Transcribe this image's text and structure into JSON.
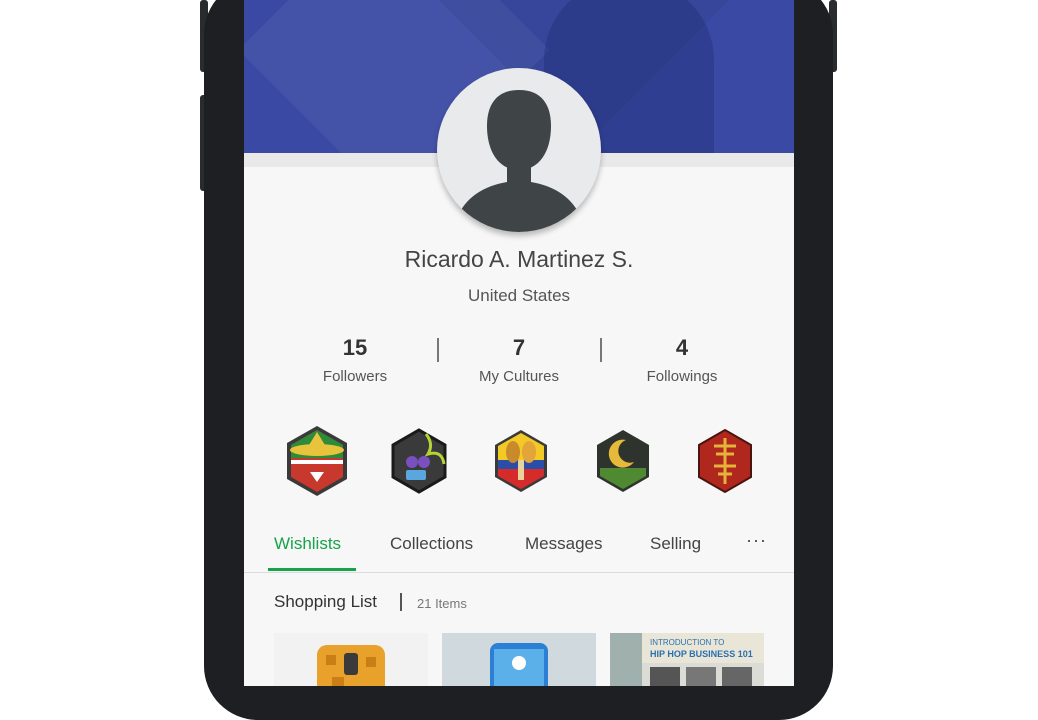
{
  "profile": {
    "name": "Ricardo A. Martinez S.",
    "country": "United States"
  },
  "stats": [
    {
      "value": "15",
      "label": "Followers"
    },
    {
      "value": "7",
      "label": "My Cultures"
    },
    {
      "value": "4",
      "label": "Followings"
    }
  ],
  "badges": [
    {
      "icon": "mexican-culture-badge-icon"
    },
    {
      "icon": "hip-hop-culture-badge-icon"
    },
    {
      "icon": "colombian-culture-badge-icon"
    },
    {
      "icon": "islamic-culture-badge-icon"
    },
    {
      "icon": "chinese-culture-badge-icon"
    }
  ],
  "tabs": {
    "items": [
      "Wishlists",
      "Collections",
      "Messages",
      "Selling"
    ],
    "more": "···",
    "active": "Wishlists"
  },
  "section": {
    "title": "Shopping List",
    "count": "21 Items"
  },
  "products": {
    "book_title_line1": "INTRODUCTION TO",
    "book_title_line2": "HIP HOP BUSINESS 101"
  },
  "colors": {
    "accent": "#17a34a",
    "banner": "#3a4aa4"
  }
}
